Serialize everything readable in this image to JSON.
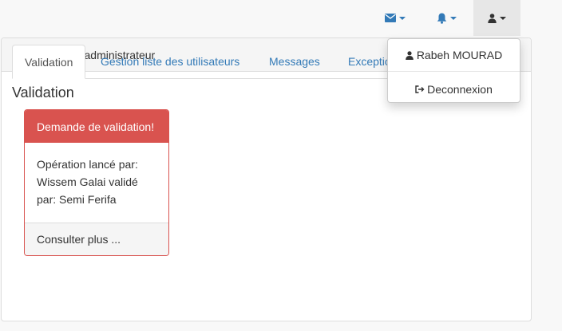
{
  "navbar": {
    "icons": [
      "envelope-icon",
      "bell-icon",
      "user-icon"
    ],
    "accent_color": "#337ab7"
  },
  "panel": {
    "heading": "Espace super administrateur"
  },
  "tabs": [
    {
      "label": "Validation",
      "active": true
    },
    {
      "label": "Gestion liste des utilisateurs",
      "active": false
    },
    {
      "label": "Messages",
      "active": false
    },
    {
      "label": "Exceptions",
      "active": false
    }
  ],
  "section": {
    "title": "Validation"
  },
  "card": {
    "header": "Demande de validation!",
    "body_line1": "Opération lancé par:",
    "body_line2": "Wissem Galai validé",
    "body_line3": "par: Semi Ferifa",
    "footer": "Consulter plus ...",
    "color": "#d9534f"
  },
  "user_menu": {
    "user_name": "Rabeh MOURAD",
    "logout_label": "Deconnexion"
  }
}
